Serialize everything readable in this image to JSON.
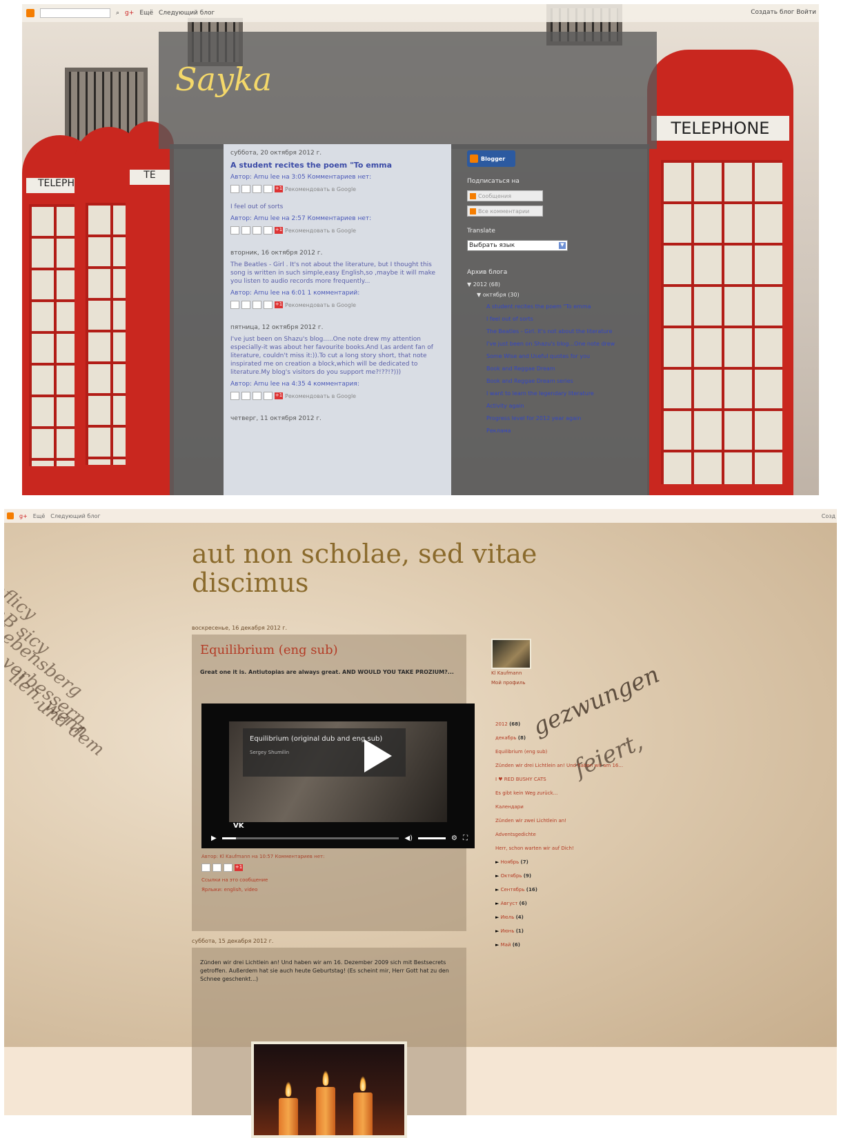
{
  "screen1": {
    "navbar": {
      "more": "Ещё",
      "next_blog": "Следующий блог",
      "create_blog": "Создать блог",
      "signin": "Войти"
    },
    "booth_signs": [
      "TELEPHONE",
      "TELEPHONE",
      "TELEPHO",
      "TELEPHONE",
      "TE"
    ],
    "blog_title": "Sayka",
    "posts": [
      {
        "date": "суббота, 20 октября 2012 г.",
        "title": "A student recites the poem \"To emma",
        "body": "",
        "meta": "Автор: Arnu lee на 3:05    Комментариев нет:"
      },
      {
        "date": "",
        "title": "",
        "body": "I feel out of sorts",
        "meta": "Автор: Arnu lee на 2:57    Комментариев нет:"
      },
      {
        "date": "вторник, 16 октября 2012 г.",
        "title": "",
        "body": "The Beatles - Girl . It's not about the literature, but I thought this song is written in such simple,easy English,so ,maybe it will make you listen to audio records more frequently...",
        "meta": "Автор: Arnu lee на 6:01    1 комментарий:"
      },
      {
        "date": "пятница, 12 октября 2012 г.",
        "title": "",
        "body": "I've just been on Shazu's blog.....One note drew my attention especially-it was about her favourite books.And I,as ardent fan of literature, couldn't miss it:)).To cut a long story short, that note inspirated me on creation a block,which will be dedicated to literature.My blog's visitors do you support me?!??!?)))",
        "meta": "Автор: Arnu lee на 4:35    4 комментария:"
      },
      {
        "date": "четверг, 11 октября 2012 г.",
        "title": "",
        "body": "",
        "meta": ""
      }
    ],
    "share_text": "Рекомендовать в Google",
    "sidebar": {
      "badge": "Blogger",
      "subscribe_heading": "Подписаться на",
      "sub_btn1": "Сообщения",
      "sub_btn2": "Все комментарии",
      "translate_heading": "Translate",
      "select_value": "Выбрать язык",
      "archive_heading": "Архив блога",
      "archive_year": "2012 (68)",
      "archive_month": "октября (30)",
      "archive_items": [
        "A student recites the poem \"To emma",
        "I feel out of sorts",
        "The Beatles - Girl. It's not about the literature",
        "I've just been on Shazu's blog...One note drew",
        "Some Wise and Useful quotes for you",
        "Book and Reggae Dream",
        "Book and Reggae Dream series",
        "I want to learn the legendary literature",
        "Activity again",
        "Progress level for 2012 year again",
        "Реклама"
      ]
    }
  },
  "screen2": {
    "navbar": {
      "more": "Ещё",
      "next_blog": "Следующий блог",
      "create_blog": "Созд"
    },
    "blog_title": "aut non scholae, sed vitae discimus",
    "post1": {
      "date": "воскресенье, 16 декабря 2012 г.",
      "title": "Equilibrium (eng sub)",
      "body": "Great one it is. Antiutopias are always great. AND WOULD YOU TAKE PROZIUM?...",
      "video_title": "Equilibrium (original dub and eng sub)",
      "video_author": "Sergey Shumilin",
      "video_brand": "VK",
      "meta": "Автор: Kl Kaufmann на 10:57    Комментариев нет:",
      "link1": "Ссылки на это сообщение",
      "link2": "Ярлыки: english, video"
    },
    "post2": {
      "date": "суббота, 15 декабря 2012 г.",
      "body": "Zünden wir drei Lichtlein an! Und haben wir am 16. Dezember 2009 sich mit Bestsecrets getroffen. Außerdem hat sie auch heute Geburtstag! (Es scheint mir, Herr Gott hat zu den Schnee geschenkt...)"
    },
    "profile": {
      "name": "Kl Kaufmann",
      "link": "Мой профиль"
    },
    "archive": [
      {
        "label": "2012",
        "count": "(68)"
      },
      {
        "label": "декабрь",
        "count": "(8)"
      },
      {
        "label": "Equilibrium (eng sub)",
        "count": ""
      },
      {
        "label": "Zünden wir drei Lichtlein an! Und haben wir am 16...",
        "count": ""
      },
      {
        "label": "I ♥ RED BUSHY CATS",
        "count": ""
      },
      {
        "label": "Es gibt kein Weg zurück...",
        "count": ""
      },
      {
        "label": "Календари",
        "count": ""
      },
      {
        "label": "Zünden wir zwei Lichtlein an!",
        "count": ""
      },
      {
        "label": "Adventsgedichte",
        "count": ""
      },
      {
        "label": "Herr, schon warten wir auf Dich!",
        "count": ""
      },
      {
        "label": "Ноябрь",
        "count": "(7)"
      },
      {
        "label": "Октябрь",
        "count": "(9)"
      },
      {
        "label": "Сентябрь",
        "count": "(16)"
      },
      {
        "label": "Август",
        "count": "(6)"
      },
      {
        "label": "Июль",
        "count": "(4)"
      },
      {
        "label": "Июнь",
        "count": "(1)"
      },
      {
        "label": "Май",
        "count": "(6)"
      }
    ],
    "book_lines": [
      "bflicy",
      "mB sicy",
      "Lebensberg",
      "n verbessern,",
      "llen, wenn",
      "und dem",
      "gezwungen",
      "feiert,"
    ]
  }
}
